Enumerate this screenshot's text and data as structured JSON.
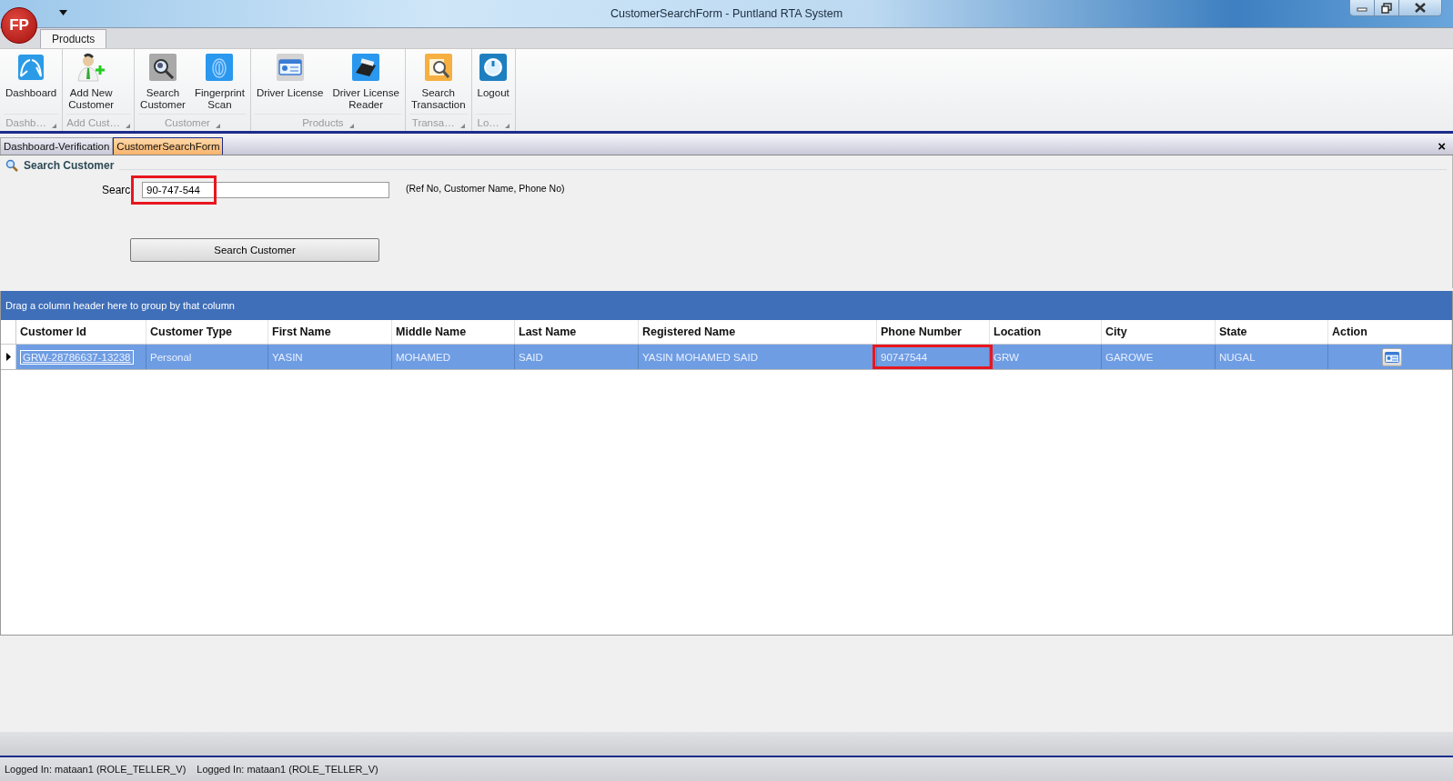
{
  "window": {
    "title": "CustomerSearchForm - Puntland RTA System",
    "logo": "FP"
  },
  "ribbon": {
    "tabs": [
      {
        "label": "Products",
        "selected": true
      }
    ],
    "groups": [
      {
        "label": "Dashb…",
        "items": [
          {
            "kind": "dashboard",
            "label": "Dashboard"
          }
        ]
      },
      {
        "label": "Add Cust…",
        "items": [
          {
            "kind": "add-user",
            "label": "Add New\nCustomer"
          }
        ]
      },
      {
        "label": "Customer",
        "items": [
          {
            "kind": "search-user",
            "label": "Search\nCustomer"
          },
          {
            "kind": "fingerprint",
            "label": "Fingerprint\nScan"
          }
        ]
      },
      {
        "label": "Products",
        "items": [
          {
            "kind": "license",
            "label": "Driver License"
          },
          {
            "kind": "reader",
            "label": "Driver License\nReader"
          }
        ]
      },
      {
        "label": "Transa…",
        "items": [
          {
            "kind": "search-doc",
            "label": "Search\nTransaction"
          }
        ]
      },
      {
        "label": "Lo…",
        "items": [
          {
            "kind": "logout",
            "label": "Logout"
          }
        ]
      }
    ]
  },
  "document_tabs": [
    {
      "label": "Dashboard-Verification",
      "selected": false
    },
    {
      "label": "CustomerSearchForm",
      "selected": true
    }
  ],
  "document_close": "×",
  "search_panel": {
    "title": "Search Customer",
    "field_label": "Searc",
    "value": "90-747-544",
    "highlighted": true,
    "hint": "(Ref No, Customer Name, Phone No)",
    "button": "Search Customer"
  },
  "grid": {
    "group_panel": "Drag a column header here to group by that column",
    "columns": [
      "Customer Id",
      "Customer Type",
      "First Name",
      "Middle Name",
      "Last Name",
      "Registered Name",
      "Phone Number",
      "Location",
      "City",
      "State",
      "Action"
    ],
    "rows": [
      {
        "selected": true,
        "cells": [
          {
            "text": "GRW-28786637-13238",
            "kind": "link",
            "highlighted": false
          },
          {
            "text": "Personal",
            "kind": "text",
            "highlighted": false
          },
          {
            "text": "YASIN",
            "kind": "text",
            "highlighted": false
          },
          {
            "text": "MOHAMED",
            "kind": "text",
            "highlighted": false
          },
          {
            "text": "SAID",
            "kind": "text",
            "highlighted": false
          },
          {
            "text": "YASIN MOHAMED SAID",
            "kind": "text",
            "highlighted": false
          },
          {
            "text": "90747544",
            "kind": "text",
            "highlighted": true
          },
          {
            "text": "GRW",
            "kind": "text",
            "highlighted": false
          },
          {
            "text": "GAROWE",
            "kind": "text",
            "highlighted": false
          },
          {
            "text": "NUGAL",
            "kind": "text",
            "highlighted": false
          },
          {
            "kind": "action",
            "highlighted": false
          }
        ]
      }
    ]
  },
  "status_bar": [
    "Logged In: mataan1 (ROLE_TELLER_V)",
    "Logged In: mataan1 (ROLE_TELLER_V)"
  ]
}
